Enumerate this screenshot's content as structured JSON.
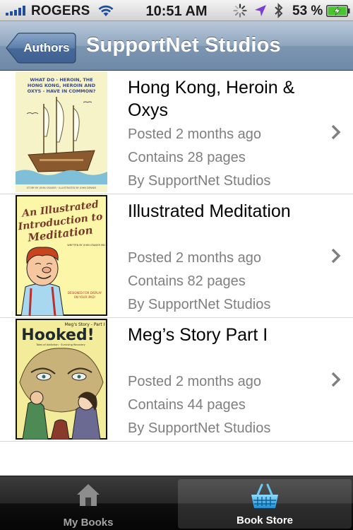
{
  "status_bar": {
    "carrier": "ROGERS",
    "time": "10:51 AM",
    "battery_percent": "53 %",
    "icons": [
      "signal-bars-icon",
      "wifi-icon",
      "activity-spinner-icon",
      "location-arrow-icon",
      "bluetooth-icon",
      "battery-charging-icon"
    ]
  },
  "nav_bar": {
    "back_label": "Authors",
    "title": "SupportNet Studios"
  },
  "books": [
    {
      "title": "Hong Kong, Heroin & Oxys",
      "posted": "Posted 2 months ago",
      "pages": "Contains 28 pages",
      "author": "By SupportNet Studios",
      "cover_text": "WHAT DO - HEROIN, THE HONG KONG, HEROIN AND OXYS - HAVE IN COMMON?"
    },
    {
      "title": "Illustrated Meditation",
      "posted": "Posted 2 months ago",
      "pages": "Contains 82 pages",
      "author": "By SupportNet Studios",
      "cover_text": "An Illustrated Introduction to Meditation"
    },
    {
      "title": "Meg’s Story Part I",
      "posted": "Posted 2 months ago",
      "pages": "Contains 44 pages",
      "author": "By SupportNet Studios",
      "cover_text": "Hooked!",
      "cover_subtitle": "Meg's Story - Part I"
    }
  ],
  "tab_bar": {
    "tabs": [
      {
        "label": "My Books",
        "icon": "house-icon",
        "selected": false
      },
      {
        "label": "Book Store",
        "icon": "basket-icon",
        "selected": true
      }
    ]
  },
  "colors": {
    "nav_bar": "#7d96b2",
    "meta_text": "#7f7f7f",
    "tab_bar": "#1a1a1a",
    "tab_selected_icon": "#3fb0e8"
  }
}
